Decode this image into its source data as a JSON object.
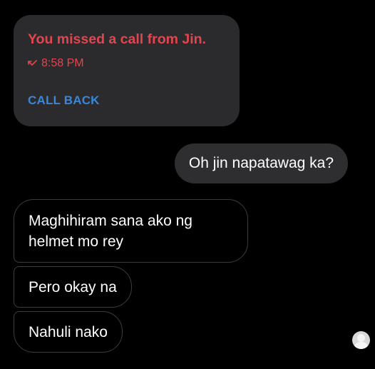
{
  "missed_call": {
    "title": "You missed a call from Jin.",
    "time": "8:58 PM",
    "action_label": "CALL BACK",
    "icon": "missed-call-arrow-icon",
    "accent_color": "#e0464f",
    "action_color": "#3a86d8"
  },
  "outgoing": [
    {
      "text": "Oh jin napatawag ka?"
    }
  ],
  "incoming": [
    {
      "text": "Maghihiram sana ako ng helmet mo rey"
    },
    {
      "text": "Pero okay na"
    },
    {
      "text": "Nahuli nako"
    }
  ],
  "read_receipt": {
    "icon": "avatar-icon"
  }
}
